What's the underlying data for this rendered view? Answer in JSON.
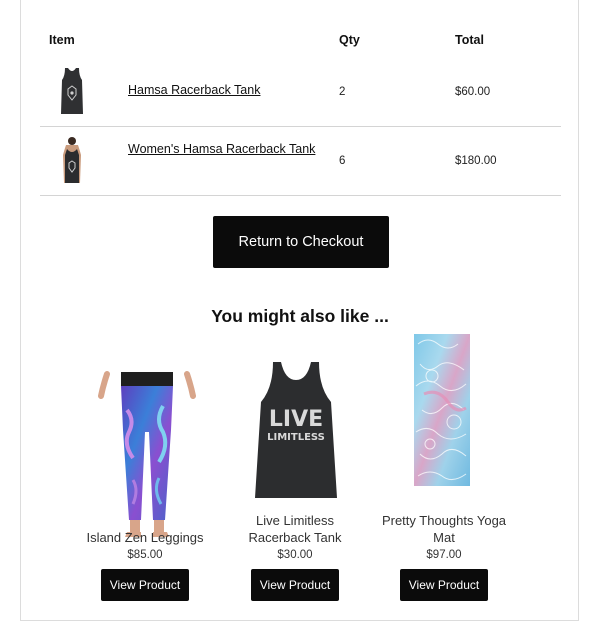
{
  "table": {
    "headers": {
      "item": "Item",
      "qty": "Qty",
      "total": "Total"
    },
    "rows": [
      {
        "name": "Hamsa Racerback Tank",
        "qty": "2",
        "total": "$60.00",
        "image": "hamsa-tank-thumbnail"
      },
      {
        "name": "Women's Hamsa Racerback Tank",
        "qty": "6",
        "total": "$180.00",
        "image": "womens-hamsa-tank-thumbnail"
      }
    ]
  },
  "checkout_button": {
    "label": "Return to Checkout"
  },
  "recommendations": {
    "title": "You might also like ...",
    "products": [
      {
        "name": "Island Zen Leggings",
        "price": "$85.00",
        "button": "View Product",
        "image": "leggings-image"
      },
      {
        "name": "Live Limitless Racerback Tank",
        "price": "$30.00",
        "button": "View Product",
        "image": "tank-image",
        "graphic_text": "LIVE LIMITLESS"
      },
      {
        "name": "Pretty Thoughts Yoga Mat",
        "price": "$97.00",
        "button": "View Product",
        "image": "yoga-mat-image"
      }
    ]
  },
  "colors": {
    "button_bg": "#0b0b0b",
    "border": "#d4d4d4"
  }
}
